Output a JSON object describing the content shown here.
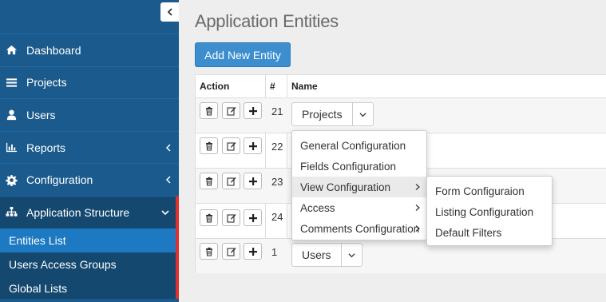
{
  "sidebar": {
    "items": [
      {
        "label": "Dashboard",
        "icon": "home-icon"
      },
      {
        "label": "Projects",
        "icon": "list-icon"
      },
      {
        "label": "Users",
        "icon": "user-icon"
      },
      {
        "label": "Reports",
        "icon": "bar-chart-icon"
      },
      {
        "label": "Configuration",
        "icon": "gear-icon"
      },
      {
        "label": "Application Structure",
        "icon": "sitemap-icon"
      }
    ],
    "subitems": [
      {
        "label": "Entities List"
      },
      {
        "label": "Users Access Groups"
      },
      {
        "label": "Global Lists"
      }
    ]
  },
  "main": {
    "title": "Application Entities",
    "add_button": "Add New Entity",
    "table": {
      "headers": [
        "Action",
        "#",
        "Name"
      ],
      "rows": [
        {
          "id": "21",
          "name": "Projects"
        },
        {
          "id": "22",
          "name": ""
        },
        {
          "id": "23",
          "name": ""
        },
        {
          "id": "24",
          "name": ""
        },
        {
          "id": "1",
          "name": "Users"
        }
      ]
    },
    "dropdown": {
      "items": [
        {
          "label": "General Configuration"
        },
        {
          "label": "Fields Configuration"
        },
        {
          "label": "View Configuration"
        },
        {
          "label": "Access"
        },
        {
          "label": "Comments Configuration"
        }
      ]
    },
    "submenu": {
      "items": [
        {
          "label": "Form Configuraion"
        },
        {
          "label": "Listing Configuration"
        },
        {
          "label": "Default Filters"
        }
      ]
    }
  },
  "colors": {
    "sidebar": "#1a5a8d",
    "sidebar_active": "#14486f",
    "sidebar_selected": "#1d79c1",
    "accent_border": "#e02f2f",
    "primary_button": "#3d8ecf"
  }
}
